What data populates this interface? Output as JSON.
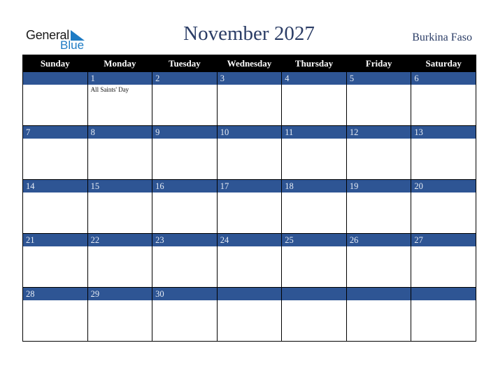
{
  "logo": {
    "line1": "General",
    "line2": "Blue",
    "icon": "triangle-flag-icon"
  },
  "header": {
    "title": "November 2027",
    "country": "Burkina Faso"
  },
  "colors": {
    "band": "#2e5594",
    "header_bg": "#000000",
    "title": "#2b3d66",
    "logo_blue": "#1e7bc4"
  },
  "weekdays": [
    "Sunday",
    "Monday",
    "Tuesday",
    "Wednesday",
    "Thursday",
    "Friday",
    "Saturday"
  ],
  "weeks": [
    [
      {
        "day": "",
        "event": ""
      },
      {
        "day": "1",
        "event": "All Saints' Day"
      },
      {
        "day": "2",
        "event": ""
      },
      {
        "day": "3",
        "event": ""
      },
      {
        "day": "4",
        "event": ""
      },
      {
        "day": "5",
        "event": ""
      },
      {
        "day": "6",
        "event": ""
      }
    ],
    [
      {
        "day": "7",
        "event": ""
      },
      {
        "day": "8",
        "event": ""
      },
      {
        "day": "9",
        "event": ""
      },
      {
        "day": "10",
        "event": ""
      },
      {
        "day": "11",
        "event": ""
      },
      {
        "day": "12",
        "event": ""
      },
      {
        "day": "13",
        "event": ""
      }
    ],
    [
      {
        "day": "14",
        "event": ""
      },
      {
        "day": "15",
        "event": ""
      },
      {
        "day": "16",
        "event": ""
      },
      {
        "day": "17",
        "event": ""
      },
      {
        "day": "18",
        "event": ""
      },
      {
        "day": "19",
        "event": ""
      },
      {
        "day": "20",
        "event": ""
      }
    ],
    [
      {
        "day": "21",
        "event": ""
      },
      {
        "day": "22",
        "event": ""
      },
      {
        "day": "23",
        "event": ""
      },
      {
        "day": "24",
        "event": ""
      },
      {
        "day": "25",
        "event": ""
      },
      {
        "day": "26",
        "event": ""
      },
      {
        "day": "27",
        "event": ""
      }
    ],
    [
      {
        "day": "28",
        "event": ""
      },
      {
        "day": "29",
        "event": ""
      },
      {
        "day": "30",
        "event": ""
      },
      {
        "day": "",
        "event": ""
      },
      {
        "day": "",
        "event": ""
      },
      {
        "day": "",
        "event": ""
      },
      {
        "day": "",
        "event": ""
      }
    ]
  ]
}
